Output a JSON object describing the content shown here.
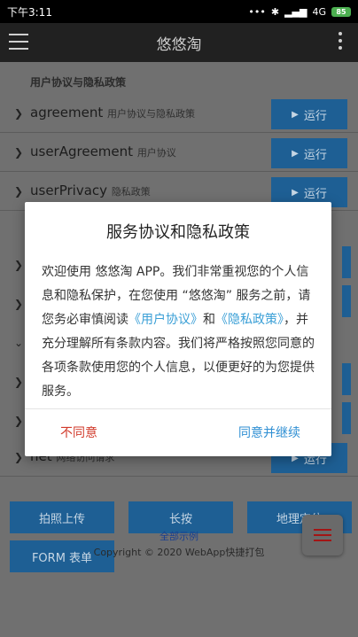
{
  "statusbar": {
    "time": "下午3:11",
    "network": "4G",
    "battery": "85",
    "signal_icon": "signal-icon",
    "bluetooth_icon": "bluetooth-icon"
  },
  "appbar": {
    "title": "悠悠淘",
    "menu_icon": "hamburger-menu-icon",
    "more_icon": "more-vert-icon"
  },
  "section": {
    "title": "用户协议与隐私政策"
  },
  "rows": [
    {
      "name": "agreement",
      "desc": "用户协议与隐私政策",
      "button": "运行"
    },
    {
      "name": "userAgreement",
      "desc": "用户协议",
      "button": "运行"
    },
    {
      "name": "userPrivacy",
      "desc": "隐私政策",
      "button": "运行"
    },
    {
      "name": "net",
      "desc": "网络访问请求",
      "button": "运行"
    }
  ],
  "grid_buttons": [
    {
      "label": "拍照上传"
    },
    {
      "label": "长按"
    },
    {
      "label": "地理定位"
    },
    {
      "label": "FORM 表单"
    }
  ],
  "footer": {
    "link": "全部示例",
    "copyright": "Copyright © 2020 WebApp快捷打包"
  },
  "dialog": {
    "title": "服务协议和隐私政策",
    "body_pre": "欢迎使用 悠悠淘 APP。我们非常重视您的个人信息和隐私保护，在您使用 “悠悠淘” 服务之前，请您务必审慎阅读",
    "link_agreement": "《用户协议》",
    "and": "和",
    "link_privacy": "《隐私政策》",
    "body_post": "，并充分理解所有条款内容。我们将严格按照您同意的各项条款使用您的个人信息，以便更好的为您提供服务。",
    "disagree": "不同意",
    "agree": "同意并继续"
  },
  "colors": {
    "button_blue": "#1e5f94",
    "link_blue": "#3a9fd6",
    "disagree_red": "#d13a2b",
    "agree_blue": "#2f8fd3"
  }
}
